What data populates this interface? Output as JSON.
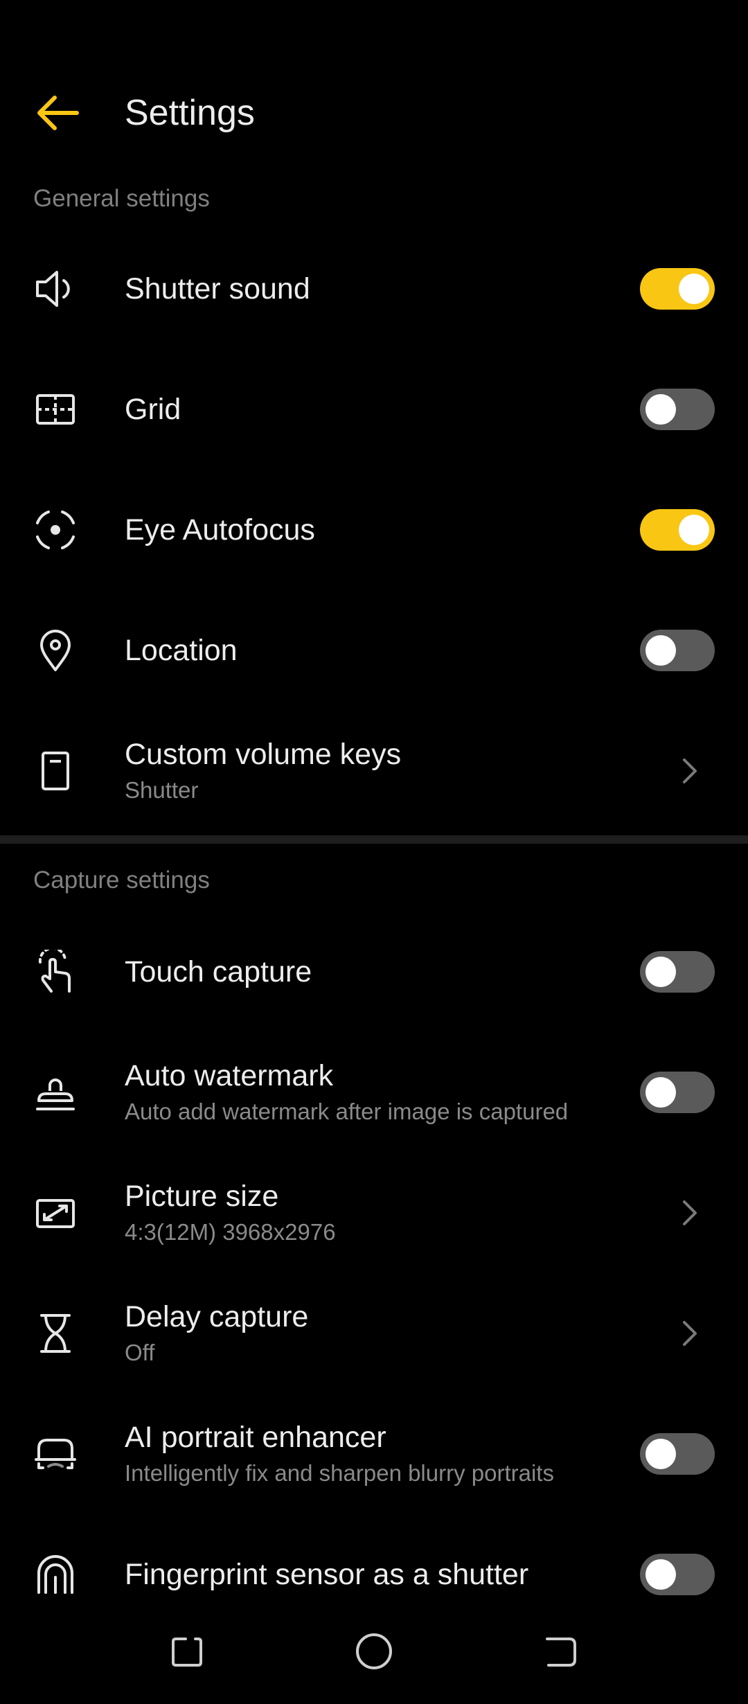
{
  "header": {
    "title": "Settings",
    "back_icon": "arrow-left-icon",
    "accent_color": "#F9C614"
  },
  "sections": {
    "general": {
      "label": "General settings",
      "items": [
        {
          "title": "Shutter sound",
          "icon": "speaker-icon",
          "control": "toggle",
          "on": true
        },
        {
          "title": "Grid",
          "icon": "grid-icon",
          "control": "toggle",
          "on": false
        },
        {
          "title": "Eye Autofocus",
          "icon": "eye-focus-icon",
          "control": "toggle",
          "on": true
        },
        {
          "title": "Location",
          "icon": "location-pin-icon",
          "control": "toggle",
          "on": false
        },
        {
          "title": "Custom volume keys",
          "subtitle": "Shutter",
          "icon": "volume-key-icon",
          "control": "chevron"
        }
      ]
    },
    "capture": {
      "label": "Capture settings",
      "items": [
        {
          "title": "Touch capture",
          "icon": "touch-icon",
          "control": "toggle",
          "on": false
        },
        {
          "title": "Auto watermark",
          "subtitle": "Auto add watermark after image is captured",
          "icon": "stamp-icon",
          "control": "toggle",
          "on": false
        },
        {
          "title": "Picture size",
          "subtitle": "4:3(12M) 3968x2976",
          "icon": "picture-size-icon",
          "control": "chevron"
        },
        {
          "title": "Delay capture",
          "subtitle": "Off",
          "icon": "hourglass-icon",
          "control": "chevron"
        },
        {
          "title": "AI portrait enhancer",
          "subtitle": "Intelligently fix and sharpen blurry portraits",
          "icon": "portrait-enhancer-icon",
          "control": "toggle",
          "on": false
        },
        {
          "title": "Fingerprint sensor as a shutter",
          "icon": "fingerprint-icon",
          "control": "toggle",
          "on": false
        }
      ]
    }
  },
  "nav": {
    "recents_icon": "recents-icon",
    "home_icon": "home-icon",
    "back_icon": "back-nav-icon"
  }
}
